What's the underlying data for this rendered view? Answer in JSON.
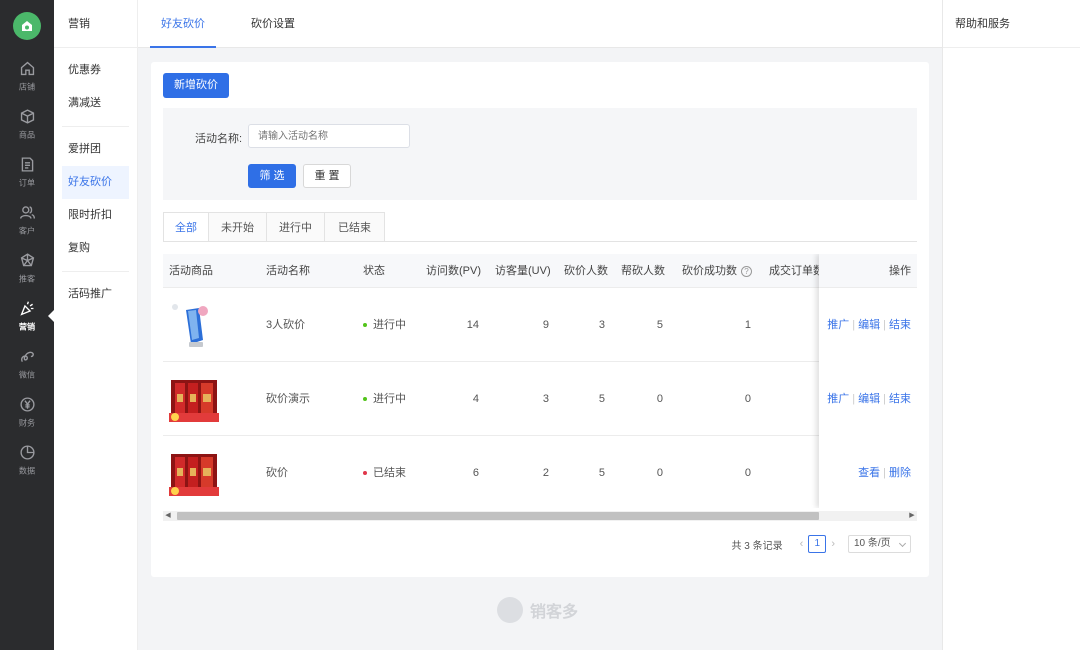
{
  "rail": {
    "items": [
      {
        "label": "店铺",
        "icon": "home-icon"
      },
      {
        "label": "商品",
        "icon": "box-icon"
      },
      {
        "label": "订单",
        "icon": "document-icon"
      },
      {
        "label": "客户",
        "icon": "users-icon"
      },
      {
        "label": "推客",
        "icon": "share-icon"
      },
      {
        "label": "营销",
        "icon": "party-icon",
        "active": true
      },
      {
        "label": "微信",
        "icon": "wechat-icon"
      },
      {
        "label": "财务",
        "icon": "yen-icon"
      },
      {
        "label": "数据",
        "icon": "pie-chart-icon"
      }
    ]
  },
  "subnav": {
    "title": "营销",
    "items": [
      "优惠券",
      "满减送",
      "爱拼团",
      "好友砍价",
      "限时折扣",
      "复购",
      "活码推广"
    ],
    "active": "好友砍价"
  },
  "topbar": {
    "tabs": [
      "好友砍价",
      "砍价设置"
    ],
    "help": "帮助和服务"
  },
  "main": {
    "add_button": "新增砍价",
    "filter": {
      "label": "活动名称:",
      "placeholder": "请输入活动名称",
      "submit": "筛 选",
      "reset": "重 置"
    },
    "status_tabs": [
      "全部",
      "未开始",
      "进行中",
      "已结束"
    ],
    "table": {
      "headers": [
        "活动商品",
        "活动名称",
        "状态",
        "访问数(PV)",
        "访客量(UV)",
        "砍价人数",
        "帮砍人数",
        "砍价成功数",
        "成交订单数",
        "操作"
      ],
      "rows": [
        {
          "name": "3人砍价",
          "status": "进行中",
          "pv": "14",
          "uv": "9",
          "bargainers": "3",
          "helpers": "5",
          "success": "1",
          "ops": [
            "推广",
            "编辑",
            "结束"
          ]
        },
        {
          "name": "砍价演示",
          "status": "进行中",
          "pv": "4",
          "uv": "3",
          "bargainers": "5",
          "helpers": "0",
          "success": "0",
          "ops": [
            "推广",
            "编辑",
            "结束"
          ]
        },
        {
          "name": "砍价",
          "status": "已结束",
          "pv": "6",
          "uv": "2",
          "bargainers": "5",
          "helpers": "0",
          "success": "0",
          "ops": [
            "查看",
            "删除"
          ]
        }
      ]
    },
    "pager": {
      "total": "共 3 条记录",
      "page": "1",
      "size": "10 条/页"
    }
  },
  "footer": {
    "brand": "销客多"
  },
  "colors": {
    "accent": "#2f6fe6",
    "active_status": "#52c41a",
    "ended_status": "#e0364a"
  }
}
